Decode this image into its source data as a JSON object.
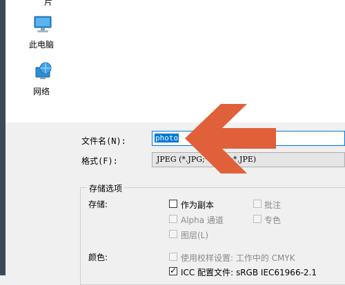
{
  "nav": {
    "top_partial": "片",
    "this_pc": "此电脑",
    "network": "网络"
  },
  "form": {
    "filename_label": "文件名(N):",
    "filename_value": "photo",
    "format_label": "格式(F):",
    "format_value": "JPEG (*.JPG;*.JPEG;*.JPE)"
  },
  "storage": {
    "group_title": "存储选项",
    "save_label": "存储:",
    "as_copy": "作为副本",
    "alpha": "Alpha 通道",
    "layers": "图层(L)",
    "annotations": "批注",
    "spot": "专色"
  },
  "color": {
    "label": "颜色:",
    "proof": "使用校样设置: 工作中的 CMYK",
    "icc": "ICC 配置文件: sRGB IEC61966-2.1"
  },
  "annotation": {
    "arrow_color": "#e0603a"
  }
}
